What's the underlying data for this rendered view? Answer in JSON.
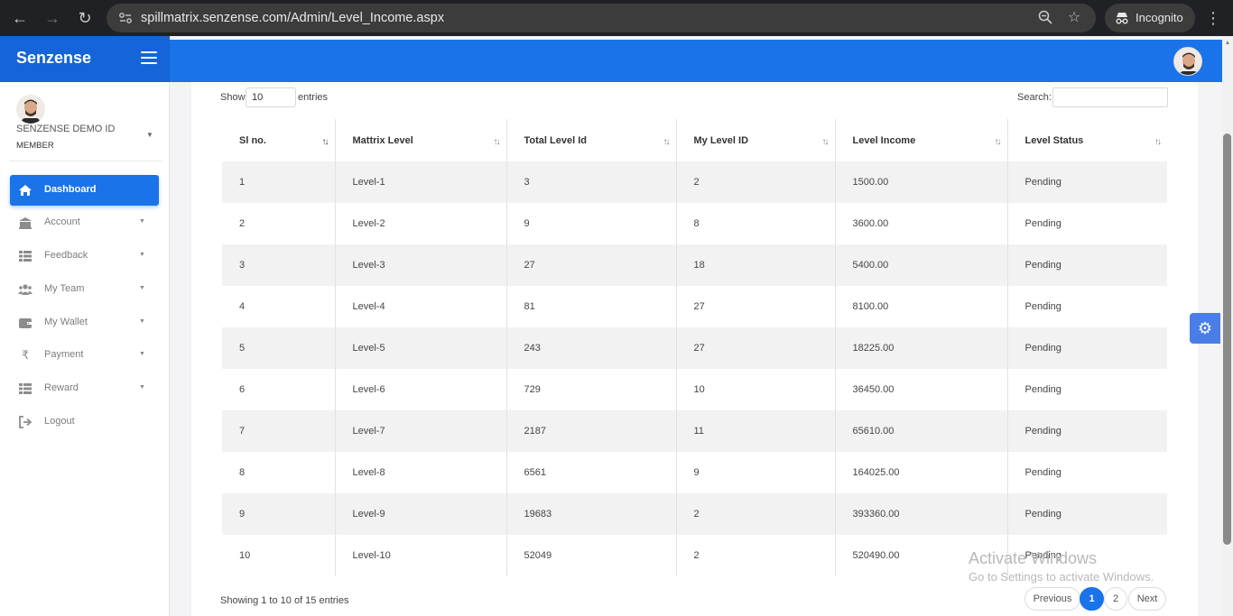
{
  "browser": {
    "url": "spillmatrix.senzense.com/Admin/Level_Income.aspx",
    "incognito_label": "Incognito",
    "icons": [
      "back-arrow-icon",
      "forward-arrow-icon",
      "reload-icon",
      "site-settings-icon",
      "zoom-icon",
      "bookmark-star-icon",
      "incognito-icon",
      "menu-kebab-icon"
    ]
  },
  "app": {
    "brand": "Senzense",
    "accent_color": "#1a73e8"
  },
  "sidebar": {
    "user_name": "SENZENSE DEMO ID",
    "user_role": "MEMBER",
    "items": [
      {
        "label": "Dashboard",
        "icon": "home-icon",
        "active": true
      },
      {
        "label": "Account",
        "icon": "bank-icon",
        "active": false
      },
      {
        "label": "Feedback",
        "icon": "table-icon",
        "active": false
      },
      {
        "label": "My Team",
        "icon": "users-icon",
        "active": false
      },
      {
        "label": "My Wallet",
        "icon": "wallet-icon",
        "active": false
      },
      {
        "label": "Payment",
        "icon": "rupee-icon",
        "active": false
      },
      {
        "label": "Reward",
        "icon": "table-icon",
        "active": false
      },
      {
        "label": "Logout",
        "icon": "logout-icon",
        "active": false
      }
    ]
  },
  "table_controls": {
    "show_label": "Show",
    "entries_value": "10",
    "entries_label": "entries",
    "search_label": "Search:"
  },
  "table": {
    "columns": [
      "Sl no.",
      "Mattrix Level",
      "Total Level Id",
      "My Level ID",
      "Level Income",
      "Level Status"
    ],
    "rows": [
      [
        "1",
        "Level-1",
        "3",
        "2",
        "1500.00",
        "Pending"
      ],
      [
        "2",
        "Level-2",
        "9",
        "8",
        "3600.00",
        "Pending"
      ],
      [
        "3",
        "Level-3",
        "27",
        "18",
        "5400.00",
        "Pending"
      ],
      [
        "4",
        "Level-4",
        "81",
        "27",
        "8100.00",
        "Pending"
      ],
      [
        "5",
        "Level-5",
        "243",
        "27",
        "18225.00",
        "Pending"
      ],
      [
        "6",
        "Level-6",
        "729",
        "10",
        "36450.00",
        "Pending"
      ],
      [
        "7",
        "Level-7",
        "2187",
        "11",
        "65610.00",
        "Pending"
      ],
      [
        "8",
        "Level-8",
        "6561",
        "9",
        "164025.00",
        "Pending"
      ],
      [
        "9",
        "Level-9",
        "19683",
        "2",
        "393360.00",
        "Pending"
      ],
      [
        "10",
        "Level-10",
        "52049",
        "2",
        "520490.00",
        "Pending"
      ]
    ]
  },
  "footer": {
    "info": "Showing 1 to 10 of 15 entries",
    "pagination": {
      "previous": "Previous",
      "pages": [
        "1",
        "2"
      ],
      "current": "1",
      "next": "Next"
    }
  },
  "watermark": {
    "title": "Activate Windows",
    "subtitle": "Go to Settings to activate Windows."
  }
}
